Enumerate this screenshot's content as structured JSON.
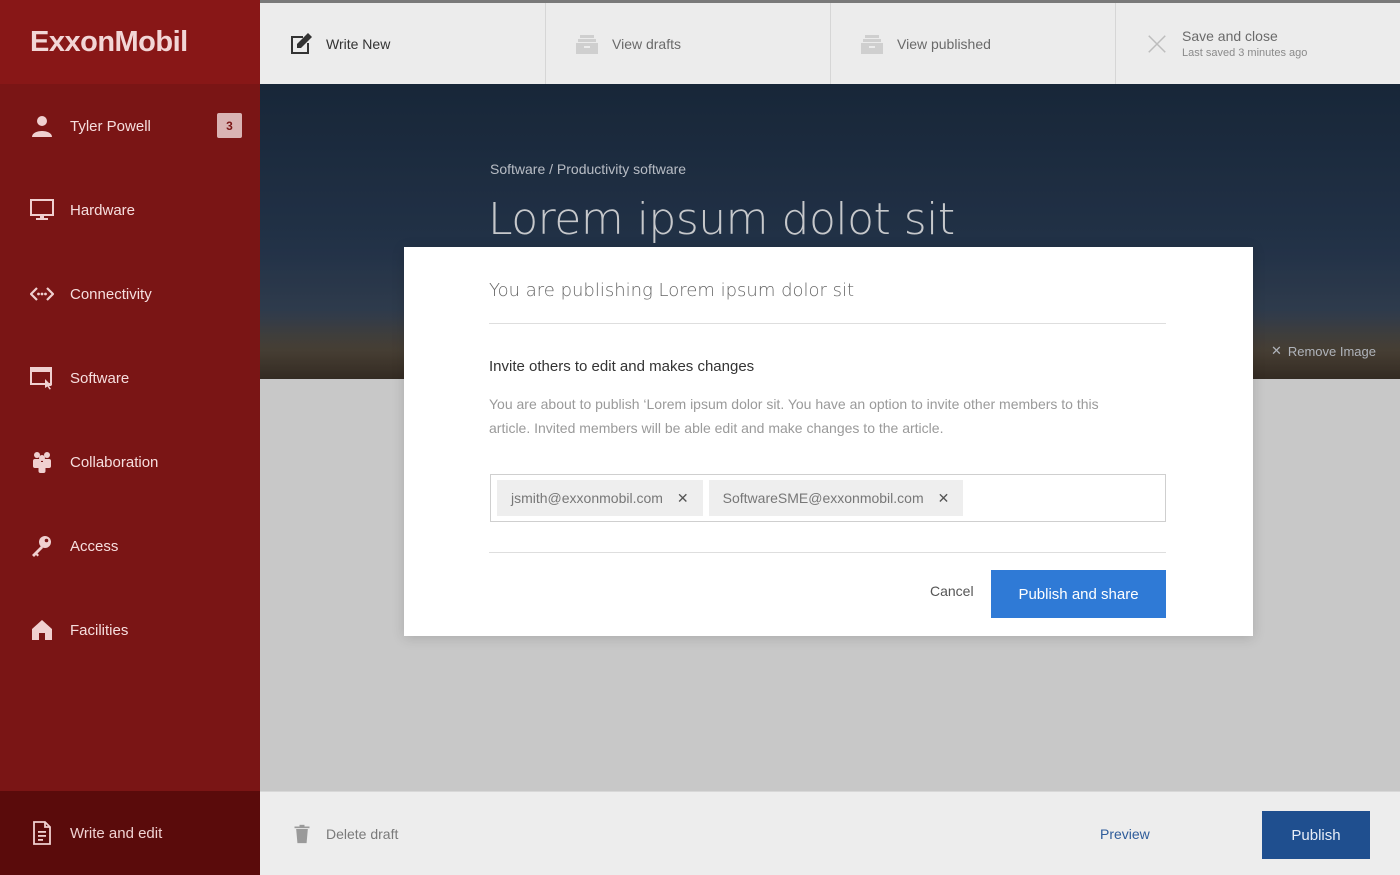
{
  "brand": {
    "logo_text": "ExxonMobil"
  },
  "sidebar": {
    "user": {
      "name": "Tyler Powell",
      "badge": "3"
    },
    "items": [
      {
        "label": "Hardware",
        "icon": "monitor-icon"
      },
      {
        "label": "Connectivity",
        "icon": "connectivity-icon"
      },
      {
        "label": "Software",
        "icon": "software-window-icon"
      },
      {
        "label": "Collaboration",
        "icon": "people-icon"
      },
      {
        "label": "Access",
        "icon": "key-icon"
      },
      {
        "label": "Facilities",
        "icon": "home-icon"
      }
    ],
    "bottom": {
      "label": "Write and edit",
      "icon": "document-icon"
    }
  },
  "topbar": {
    "write_new": "Write New",
    "view_drafts": "View drafts",
    "view_published": "View published",
    "save_close": "Save and close",
    "last_saved": "Last saved 3 minutes ago"
  },
  "hero": {
    "breadcrumb": "Software / Productivity software",
    "title": "Lorem ipsum dolot sit",
    "remove_image": "Remove Image"
  },
  "modal": {
    "title": "You are publishing Lorem ipsum dolor sit",
    "heading": "Invite others to edit and makes changes",
    "description": "You are about to publish ‘Lorem ipsum dolor sit. You have an option to invite other members to this article. Invited members will be able edit and make changes to the article.",
    "invitees": [
      "jsmith@exxonmobil.com",
      "SoftwareSME@exxonmobil.com"
    ],
    "cancel_label": "Cancel",
    "publish_share_label": "Publish and share"
  },
  "footer": {
    "delete_label": "Delete draft",
    "preview_label": "Preview",
    "publish_label": "Publish"
  },
  "colors": {
    "sidebar": "#7a1515",
    "sidebar_active": "#5a0b0b",
    "primary_blue": "#2f7ad6",
    "publish_blue": "#1f4f8f"
  }
}
